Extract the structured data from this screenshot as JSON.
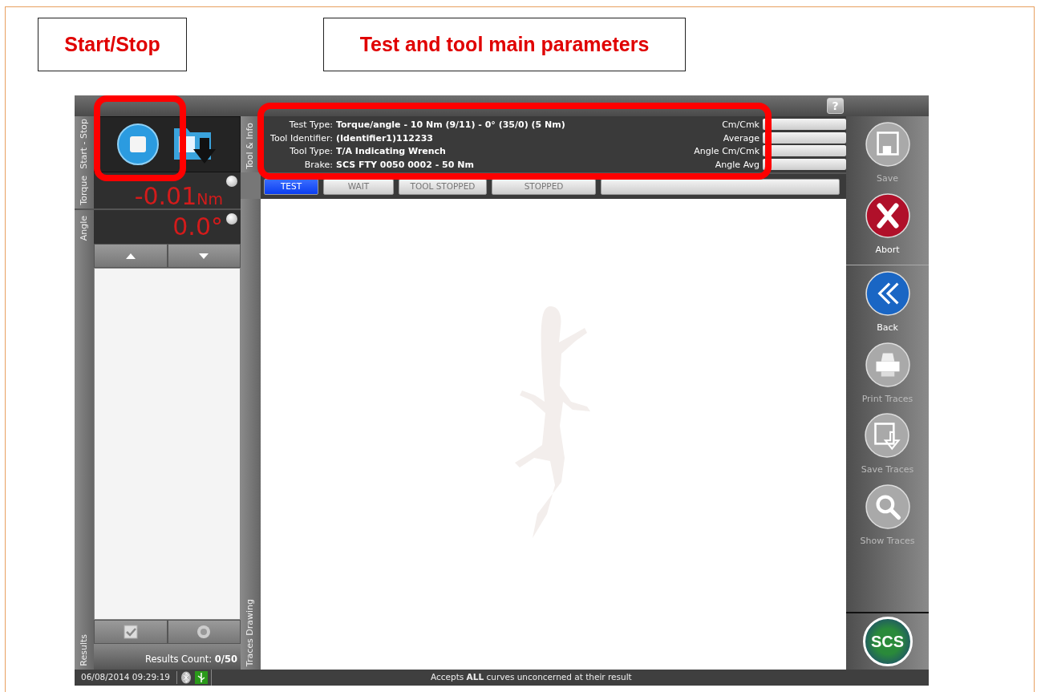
{
  "annotations": [
    {
      "label": "Start/Stop"
    },
    {
      "label": "Test and tool main parameters"
    }
  ],
  "app": {
    "left_tabs": [
      "Start - Stop",
      "Torque",
      "Angle",
      "Results"
    ],
    "middle_tabs": [
      "Tool & Info",
      "Traces Drawing"
    ],
    "torque": {
      "value": "-0.01",
      "unit": "Nm"
    },
    "angle": {
      "value": "0.0°"
    },
    "info": [
      {
        "label": "Test Type:",
        "value": "Torque/angle - 10 Nm (9/11) - 0° (35/0) (5 Nm)"
      },
      {
        "label": "Tool Identifier:",
        "value": "(Identifier1)112233"
      },
      {
        "label": "Tool Type:",
        "value": "T/A Indicating Wrench"
      },
      {
        "label": "Brake:",
        "value": "SCS FTY 0050 0002 - 50 Nm"
      }
    ],
    "stats": [
      "Cm/Cmk",
      "Average",
      "Angle Cm/Cmk",
      "Angle Avg"
    ],
    "status_buttons": [
      {
        "label": "TEST",
        "selected": true
      },
      {
        "label": "WAIT",
        "selected": false
      },
      {
        "label": "TOOL STOPPED",
        "selected": false
      },
      {
        "label": "STOPPED",
        "selected": false
      }
    ],
    "results_count": {
      "label": "Results Count:",
      "value": "0/50"
    },
    "sidebar": [
      [
        {
          "kind": "save",
          "label": "Save",
          "disabled": true
        },
        {
          "kind": "abort",
          "label": "Abort",
          "disabled": false
        }
      ],
      [
        {
          "kind": "back",
          "label": "Back",
          "disabled": false
        },
        {
          "kind": "print",
          "label": "Print Traces",
          "disabled": true
        },
        {
          "kind": "savetraces",
          "label": "Save Traces",
          "disabled": true
        },
        {
          "kind": "show",
          "label": "Show Traces",
          "disabled": true
        }
      ]
    ],
    "logo": "SCS",
    "help": "?",
    "status_bar": {
      "datetime": "06/08/2014 09:29:19",
      "message": "Accepts **ALL** curves unconcerned at their result"
    }
  }
}
